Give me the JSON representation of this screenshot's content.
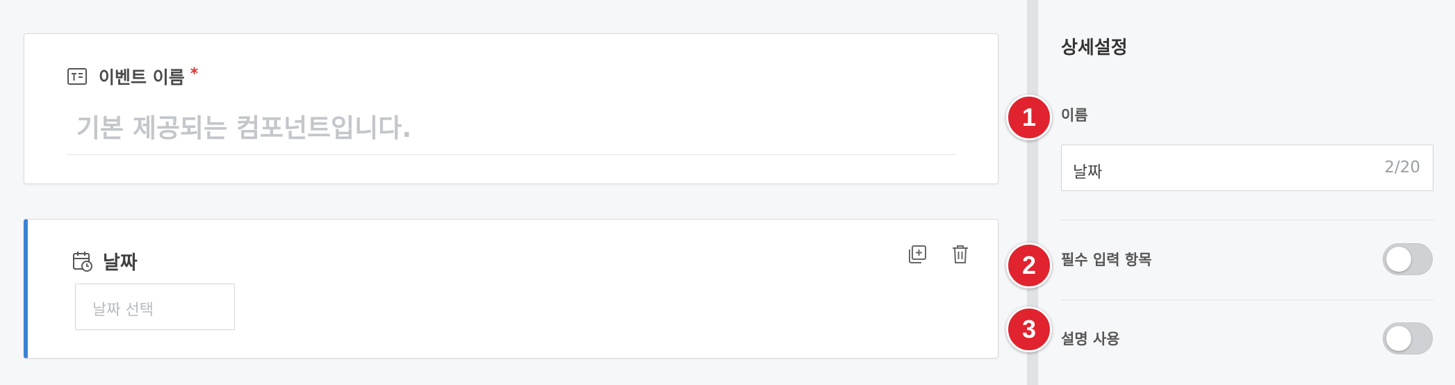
{
  "form": {
    "event_card": {
      "title": "이벤트 이름",
      "required_mark": "*",
      "placeholder": "기본 제공되는 컴포넌트입니다."
    },
    "date_card": {
      "title": "날짜",
      "date_placeholder": "날짜 선택",
      "accent_color": "#3b82d6",
      "actions": [
        "copy-add-icon",
        "trash-icon"
      ]
    }
  },
  "panel": {
    "title": "상세설정",
    "name_label": "이름",
    "name_value": "날짜",
    "name_counter": "2/20",
    "required_label": "필수 입력 항목",
    "required_on": false,
    "description_label": "설명 사용",
    "description_on": false
  },
  "badges": [
    "1",
    "2",
    "3"
  ],
  "colors": {
    "badge": "#e0232e",
    "accent": "#3b82d6",
    "required": "#e03131"
  }
}
